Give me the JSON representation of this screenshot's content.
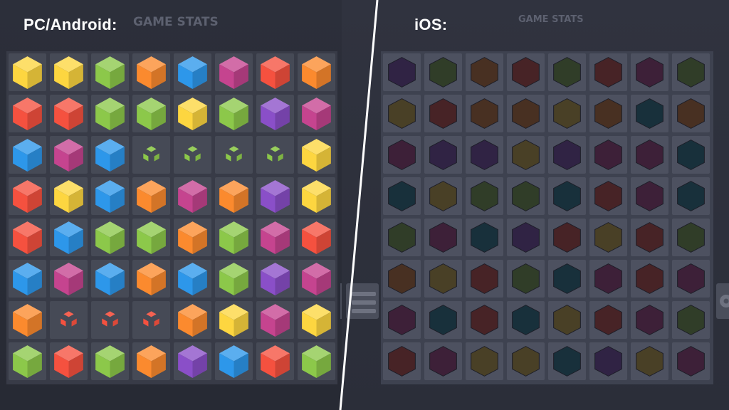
{
  "left_panel": {
    "platform_label": "PC/Android:",
    "stats_label": "GAME STATS",
    "board_rows": [
      [
        "yellow",
        "yellow",
        "green",
        "orange",
        "blue",
        "magenta",
        "red",
        "orange"
      ],
      [
        "red",
        "red",
        "green",
        "green",
        "yellow",
        "green",
        "purple",
        "magenta"
      ],
      [
        "blue",
        "magenta",
        "blue",
        "green-shattered",
        "green-shattered",
        "green-shattered",
        "green-shattered",
        "yellow"
      ],
      [
        "red",
        "yellow",
        "blue",
        "orange",
        "magenta",
        "orange",
        "purple",
        "yellow"
      ],
      [
        "red",
        "blue",
        "green",
        "green",
        "orange",
        "green",
        "magenta",
        "red"
      ],
      [
        "blue",
        "magenta",
        "blue",
        "orange",
        "blue",
        "green",
        "purple",
        "magenta"
      ],
      [
        "orange",
        "red-shattered",
        "red-shattered",
        "red-shattered",
        "orange",
        "yellow",
        "magenta",
        "yellow"
      ],
      [
        "green",
        "red",
        "green",
        "orange",
        "purple",
        "blue",
        "red",
        "green"
      ]
    ]
  },
  "right_panel": {
    "platform_label": "iOS:",
    "stats_label": "GAME STATS",
    "board_rows": [
      [
        "purple",
        "green",
        "orange",
        "red",
        "green",
        "red",
        "magenta",
        "green"
      ],
      [
        "yellow",
        "red",
        "orange",
        "orange",
        "yellow",
        "orange",
        "teal",
        "orange"
      ],
      [
        "magenta",
        "purple",
        "purple",
        "yellow",
        "purple",
        "magenta",
        "magenta",
        "teal"
      ],
      [
        "teal",
        "yellow",
        "green",
        "green",
        "teal",
        "red",
        "magenta",
        "teal"
      ],
      [
        "green",
        "magenta",
        "teal",
        "purple",
        "red",
        "yellow",
        "red",
        "green"
      ],
      [
        "orange",
        "yellow",
        "red",
        "green",
        "teal",
        "magenta",
        "red",
        "magenta"
      ],
      [
        "magenta",
        "teal",
        "red",
        "teal",
        "yellow",
        "red",
        "magenta",
        "green"
      ],
      [
        "red",
        "magenta",
        "yellow",
        "yellow",
        "teal",
        "purple",
        "yellow",
        "magenta"
      ]
    ]
  },
  "colors": {
    "yellow": "#fdd640",
    "green": "#8cc84a",
    "orange": "#fb8a2e",
    "blue": "#2d97ea",
    "magenta": "#c5448f",
    "red": "#f5513f",
    "purple": "#8a4fc8",
    "teal": "#1e8ba0"
  }
}
